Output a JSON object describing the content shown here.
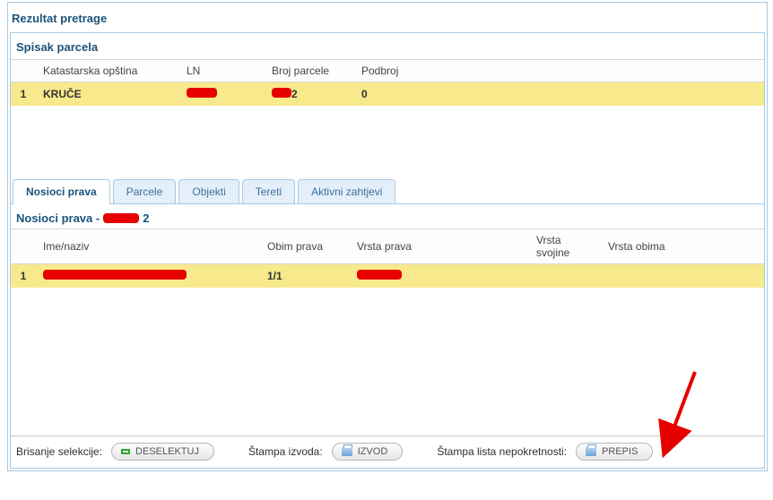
{
  "page_title": "Rezultat pretrage",
  "parcels": {
    "title": "Spisak parcela",
    "columns": {
      "c0": "",
      "c1": "Katastarska opština",
      "c2": "LN",
      "c3": "Broj parcele",
      "c4": "Podbroj"
    },
    "rows": [
      {
        "n": "1",
        "opstina": "KRUČE",
        "ln": "",
        "broj": "2",
        "podbroj": "0"
      }
    ]
  },
  "tabs": {
    "t0": "Nosioci prava",
    "t1": "Parcele",
    "t2": "Objekti",
    "t3": "Tereti",
    "t4": "Aktivni zahtjevi"
  },
  "rights": {
    "title_prefix": "Nosioci prava -",
    "title_suffix": "2",
    "columns": {
      "c0": "",
      "c1": "Ime/naziv",
      "c2": "Obim prava",
      "c3": "Vrsta prava",
      "c4": "Vrsta svojine",
      "c5": "Vrsta obima"
    },
    "rows": [
      {
        "n": "1",
        "ime": "",
        "obim": "1/1",
        "vrsta": ""
      }
    ]
  },
  "footer": {
    "brisanje": "Brisanje selekcije:",
    "deselekt": "DESELEKTUJ",
    "stampa_izvoda": "Štampa izvoda:",
    "izvod": "IZVOD",
    "stampa_lista": "Štampa lista nepokretnosti:",
    "prepis": "PREPIS"
  }
}
